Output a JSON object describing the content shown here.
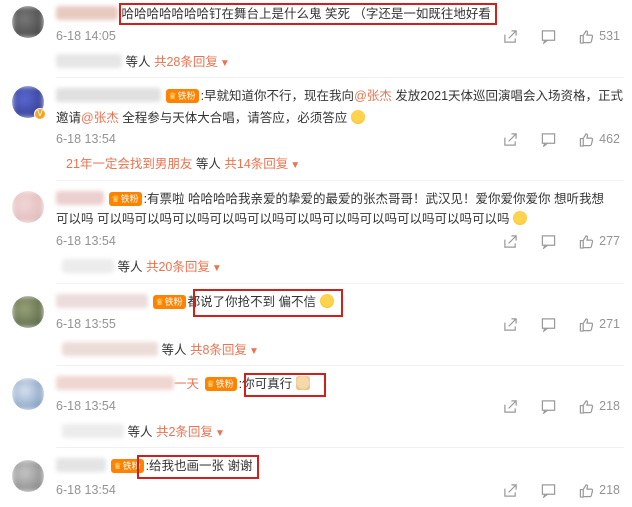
{
  "colors": {
    "accent": "#eb7350",
    "highlight": "#d0201b",
    "fan_badge": "#ff8200",
    "muted": "#939393"
  },
  "comments": [
    {
      "text": "哈哈哈哈哈哈哈钉在舞台上是什么鬼 笑死 （字还是一如既往地好看",
      "time": "6-18 14:05",
      "likes": "531",
      "replies": {
        "prefix": "",
        "label": "等人",
        "count": "共28条回复"
      }
    },
    {
      "badge": "铁粉",
      "text_a": ":早就知道你不行，现在我向",
      "at1": "@张杰",
      "text_b": " 发放2021天体巡回演唱会入场资格，正式",
      "text_c": "邀请",
      "at2": "@张杰",
      "text_d": " 全程参与天体大合唱，请答应，必须答应",
      "time": "6-18 13:54",
      "likes": "462",
      "replies": {
        "prefix": "21年一定会找到男朋友",
        "label": "等人",
        "count": "共14条回复"
      }
    },
    {
      "badge": "铁粉",
      "text_a": ":有票啦 哈哈哈哈我亲爱的挚爱的最爱的张杰哥哥！武汉见！爱你爱你爱你 想听我想",
      "text_b": "可以吗 可以吗可以吗可以吗可以吗可以吗可以吗可以吗可以吗可以吗可以吗可以吗",
      "time": "6-18 13:54",
      "likes": "277",
      "replies": {
        "prefix": "",
        "label": "等人",
        "count": "共20条回复"
      }
    },
    {
      "badge": "铁粉",
      "text": "都说了你抢不到 偏不信",
      "time": "6-18 13:55",
      "likes": "271",
      "replies": {
        "prefix": "",
        "label": "等人",
        "count": "共8条回复"
      }
    },
    {
      "name_tail": "一天",
      "badge": "铁粉",
      "text": ":你可真行",
      "time": "6-18 13:54",
      "likes": "218",
      "replies": {
        "prefix": "",
        "label": "等人",
        "count": "共2条回复"
      }
    },
    {
      "badge": "铁粉",
      "text": ":给我也画一张 谢谢",
      "time": "6-18 13:54",
      "likes": "218"
    }
  ],
  "icons": {
    "share": "share-icon",
    "comment": "comment-icon",
    "like": "like-icon",
    "vip": "vip-badge-icon"
  }
}
